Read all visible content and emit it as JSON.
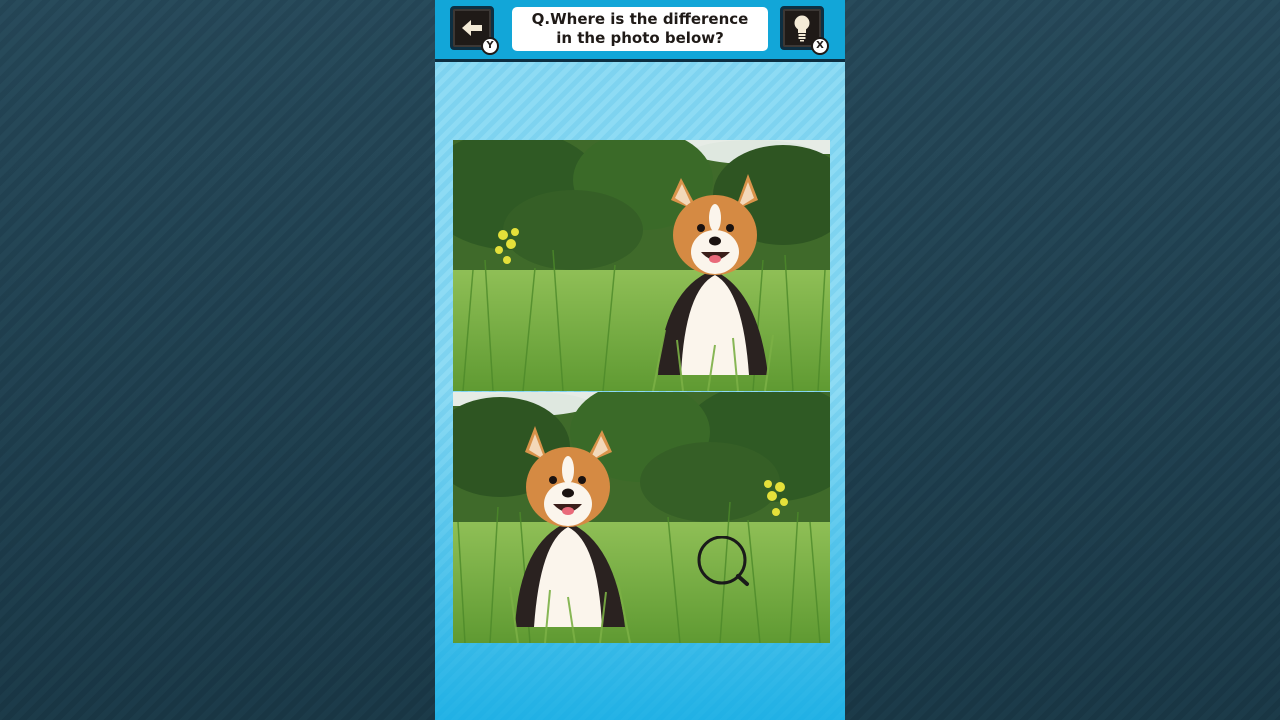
{
  "question": {
    "line1": "Q.Where is the difference",
    "line2": "in the photo below?"
  },
  "buttons": {
    "back": {
      "icon": "arrow-left-icon",
      "key": "Y"
    },
    "hint": {
      "icon": "lightbulb-icon",
      "key": "X"
    }
  },
  "photos": [
    {
      "id": "reference",
      "subject": "corgi in grass",
      "dog_side": "right",
      "flowers_side": "left"
    },
    {
      "id": "mirrored",
      "subject": "corgi in grass",
      "dog_side": "left",
      "flowers_side": "right"
    }
  ],
  "cursor": {
    "icon": "magnifier-icon"
  },
  "colors": {
    "topbar": "#12a6d8",
    "panel": "#8ddbf4",
    "background": "#214556",
    "button": "#1f1a17"
  }
}
